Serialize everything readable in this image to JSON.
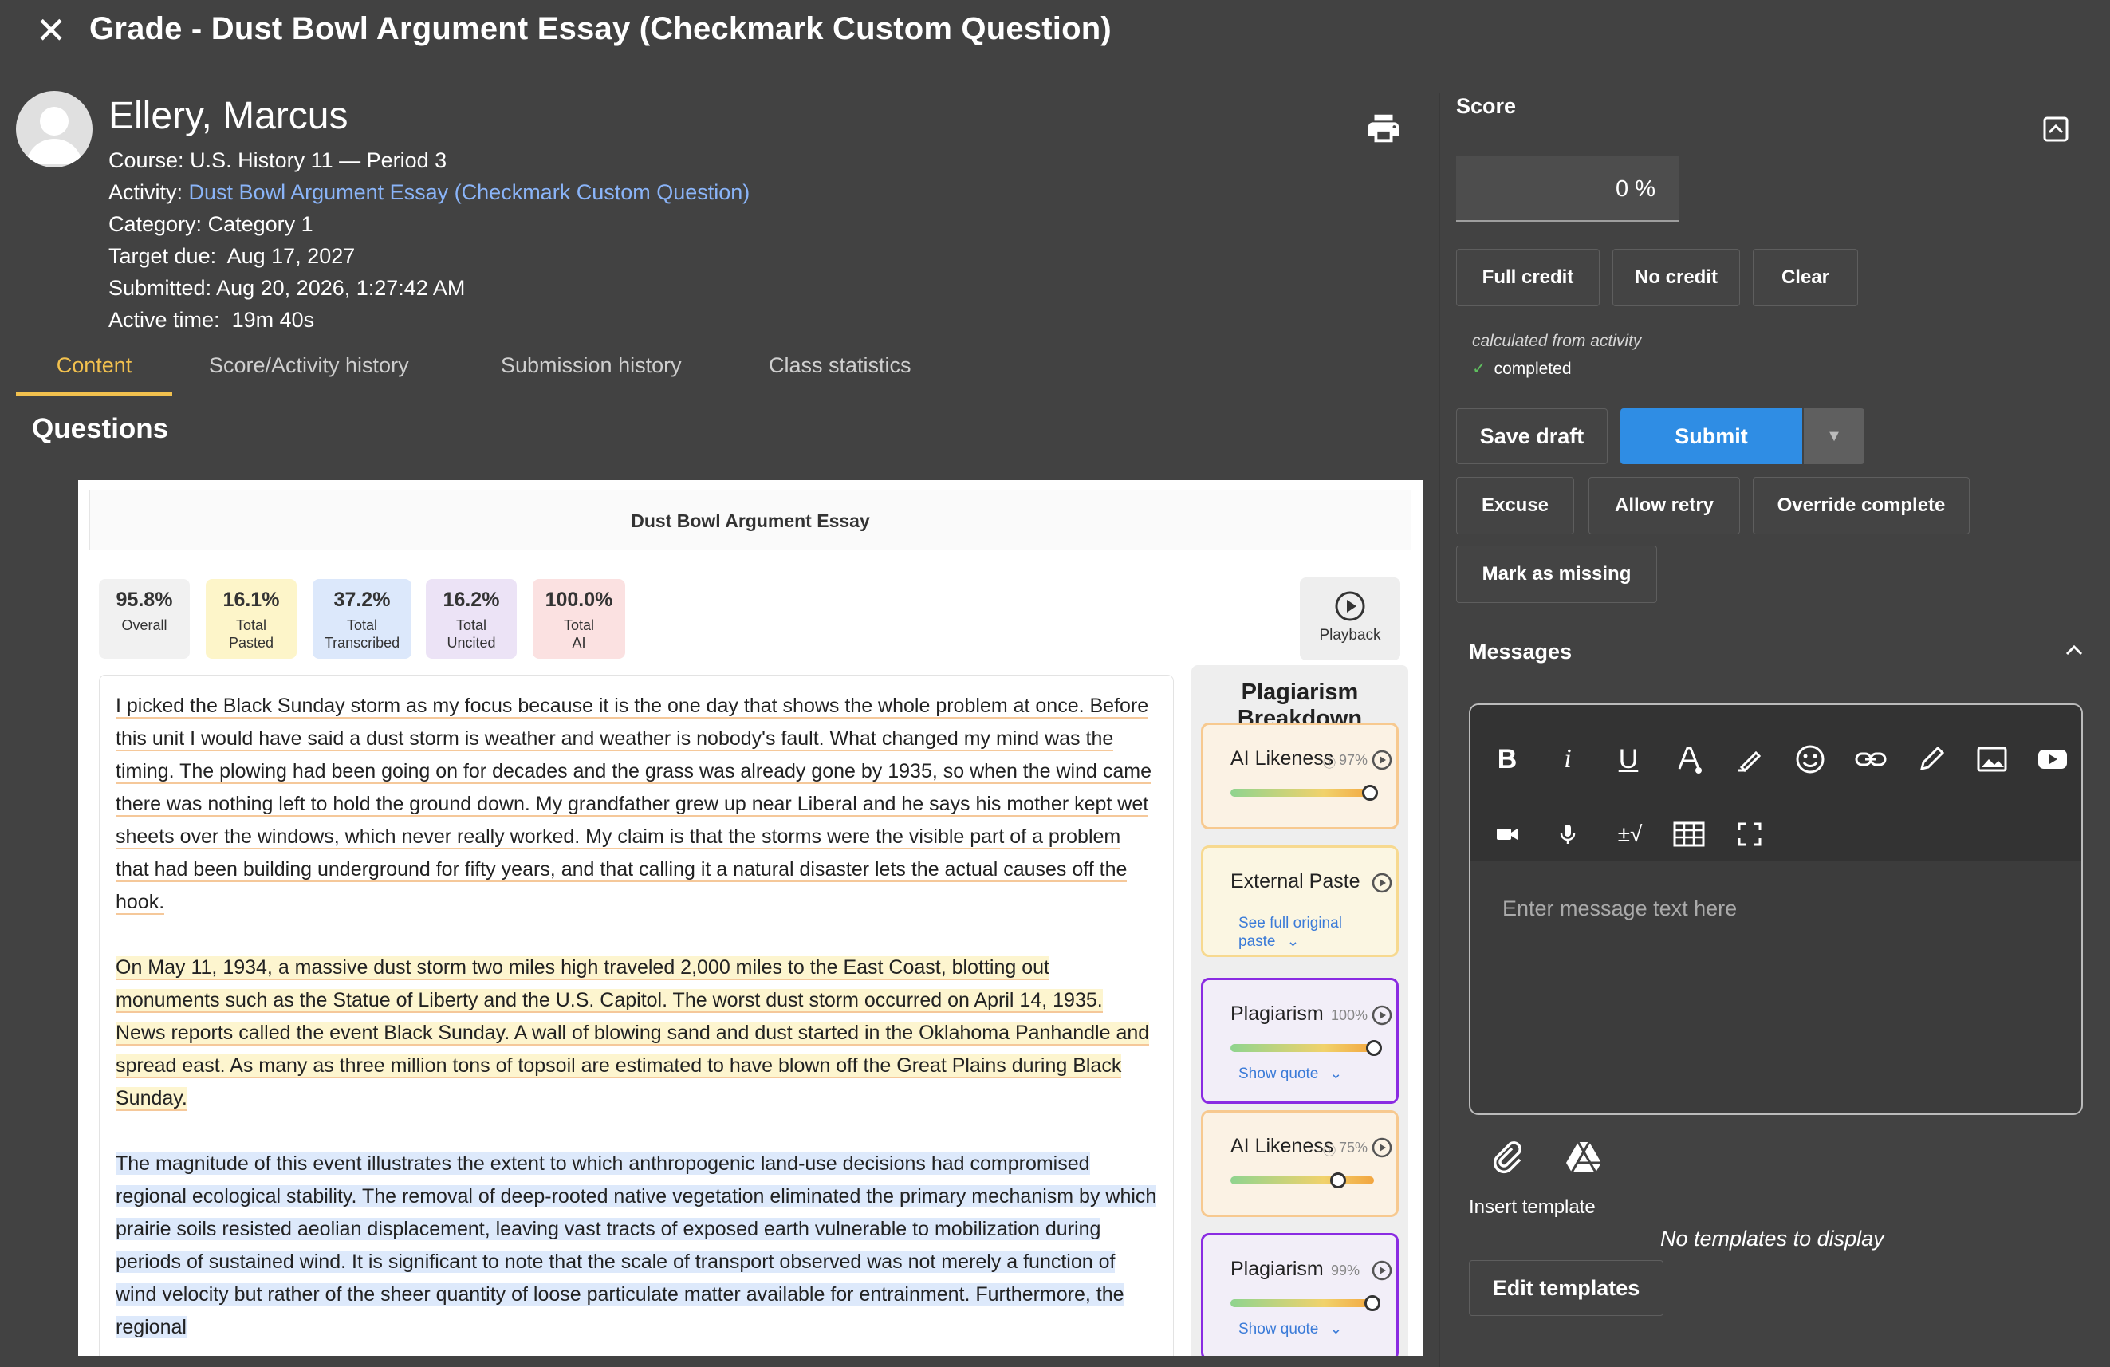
{
  "header": {
    "title": "Grade - Dust Bowl Argument Essay (Checkmark Custom Question)"
  },
  "student": {
    "name": "Ellery, Marcus",
    "course_label": "Course:",
    "course": "U.S. History 11 — Period 3",
    "activity_label": "Activity:",
    "activity": "Dust Bowl Argument Essay (Checkmark Custom Question)",
    "category_label": "Category:",
    "category": "Category 1",
    "target_label": "Target due:",
    "target": "Aug 17, 2027",
    "submitted_label": "Submitted:",
    "submitted": "Aug 20, 2026, 1:27:42 AM",
    "active_label": "Active time:",
    "active": "19m 40s"
  },
  "tabs": [
    "Content",
    "Score/Activity history",
    "Submission history",
    "Class statistics"
  ],
  "questions_heading": "Questions",
  "content": {
    "essay_title": "Dust Bowl Argument Essay",
    "stats": [
      {
        "value": "95.8%",
        "label": "Overall",
        "label2": "",
        "color": "#f1f1f1"
      },
      {
        "value": "16.1%",
        "label": "Total",
        "label2": "Pasted",
        "color": "#fdf5c9"
      },
      {
        "value": "37.2%",
        "label": "Total",
        "label2": "Transcribed",
        "color": "#dce8fb"
      },
      {
        "value": "16.2%",
        "label": "Total",
        "label2": "Uncited",
        "color": "#ece3f6"
      },
      {
        "value": "100.0%",
        "label": "Total",
        "label2": "AI",
        "color": "#fbe1e1"
      }
    ],
    "playback_label": "Playback",
    "paragraphs": [
      "I picked the Black Sunday storm as my focus because it is the one day that shows the whole problem at once. Before this unit I would have said a dust storm is weather and weather is nobody's fault. What changed my mind was the timing. The plowing had been going on for decades and the grass was already gone by 1935, so when the wind came there was nothing left to hold the ground down. My grandfather grew up near Liberal and he says his mother kept wet sheets over the windows, which never really worked. My claim is that the storms were the visible part of a problem that had been building underground for fifty years, and that calling it a natural disaster lets the actual causes off the hook.",
      "On May 11, 1934, a massive dust storm two miles high traveled 2,000 miles to the East Coast, blotting out monuments such as the Statue of Liberty and the U.S. Capitol. The worst dust storm occurred on April 14, 1935. News reports called the event Black Sunday. A wall of blowing sand and dust started in the Oklahoma Panhandle and spread east. As many as three million tons of topsoil are estimated to have blown off the Great Plains during Black Sunday.",
      "The magnitude of this event illustrates the extent to which anthropogenic land-use decisions had compromised regional ecological stability. The removal of deep-rooted native vegetation eliminated the primary mechanism by which prairie soils resisted aeolian displacement, leaving vast tracts of exposed earth vulnerable to mobilization during periods of sustained wind. It is significant to note that the scale of transport observed was not merely a function of wind velocity but rather of the sheer quantity of loose particulate matter available for entrainment. Furthermore, the regional"
    ]
  },
  "plagiarism": {
    "title": "Plagiarism Breakdown",
    "cards": [
      {
        "label": "AI Likeness",
        "info": "ⓘ",
        "pct": "97%",
        "value": 0.97,
        "link": "",
        "border": "#f7c98f",
        "bg": "#fbf2e4"
      },
      {
        "label": "External Paste",
        "info": "",
        "pct": "",
        "value": null,
        "link": "See full original paste",
        "border": "#f7d98f",
        "bg": "#fbf6e2"
      },
      {
        "label": "Plagiarism",
        "info": "",
        "pct": "100%",
        "value": 1.0,
        "link": "Show quote",
        "border": "#8a2be2",
        "bg": "#f2eef8"
      },
      {
        "label": "AI Likeness",
        "info": "ⓘ",
        "pct": "75%",
        "value": 0.75,
        "link": "",
        "border": "#f7c98f",
        "bg": "#fbf2e4"
      },
      {
        "label": "Plagiarism",
        "info": "",
        "pct": "99%",
        "value": 0.99,
        "link": "Show quote",
        "border": "#8a2be2",
        "bg": "#f2eef8"
      }
    ]
  },
  "score": {
    "heading": "Score",
    "value": "0 %",
    "full_credit": "Full credit",
    "no_credit": "No credit",
    "clear": "Clear",
    "calc_note": "calculated from activity",
    "completed": "completed",
    "save_draft": "Save draft",
    "submit": "Submit",
    "excuse": "Excuse",
    "allow_retry": "Allow retry",
    "override_complete": "Override complete",
    "mark_missing": "Mark as missing"
  },
  "messages": {
    "heading": "Messages",
    "placeholder": "Enter message text here",
    "insert_template": "Insert template",
    "no_templates": "No templates to display",
    "edit_templates": "Edit templates"
  },
  "colors": {
    "accent_tab": "#f2c14e",
    "submit": "#2f8de4",
    "link": "#8ab4f8"
  }
}
